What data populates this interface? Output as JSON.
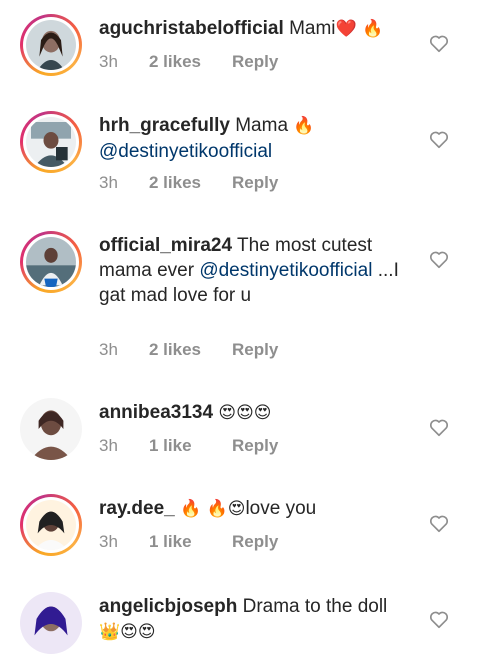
{
  "comments": [
    {
      "username": "aguchristabelofficial",
      "text": "Mami",
      "emoji": "❤️ 🔥",
      "mention": "",
      "text_after": "",
      "time": "3h",
      "likes": "2 likes",
      "reply": "Reply"
    },
    {
      "username": "hrh_gracefully",
      "text": "Mama",
      "emoji": "🔥",
      "mention": "@destinyetikoofficial",
      "text_after": "",
      "time": "3h",
      "likes": "2 likes",
      "reply": "Reply"
    },
    {
      "username": "official_mira24",
      "text": "The most cutest mama ever",
      "emoji": "",
      "mention": "@destinyetikoofficial",
      "text_after": "...I gat mad love for u",
      "time": "3h",
      "likes": "2 likes",
      "reply": "Reply"
    },
    {
      "username": "annibea3134",
      "text": "",
      "emoji": "😍😍😍",
      "mention": "",
      "text_after": "",
      "time": "3h",
      "likes": "1 like",
      "reply": "Reply"
    },
    {
      "username": "ray.dee_",
      "text": "",
      "emoji": "🔥 🔥😍",
      "mention": "",
      "text_after": "love you",
      "time": "3h",
      "likes": "1 like",
      "reply": "Reply"
    },
    {
      "username": "angelicbjoseph",
      "text": "Drama to the doll",
      "emoji": "👑😍😍",
      "mention": "",
      "text_after": "",
      "time": "",
      "likes": "",
      "reply": ""
    }
  ],
  "colors": {
    "mention": "#00376b",
    "meta": "#8e8e8e",
    "text": "#262626"
  },
  "icons": {
    "like": "heart-outline-icon"
  }
}
